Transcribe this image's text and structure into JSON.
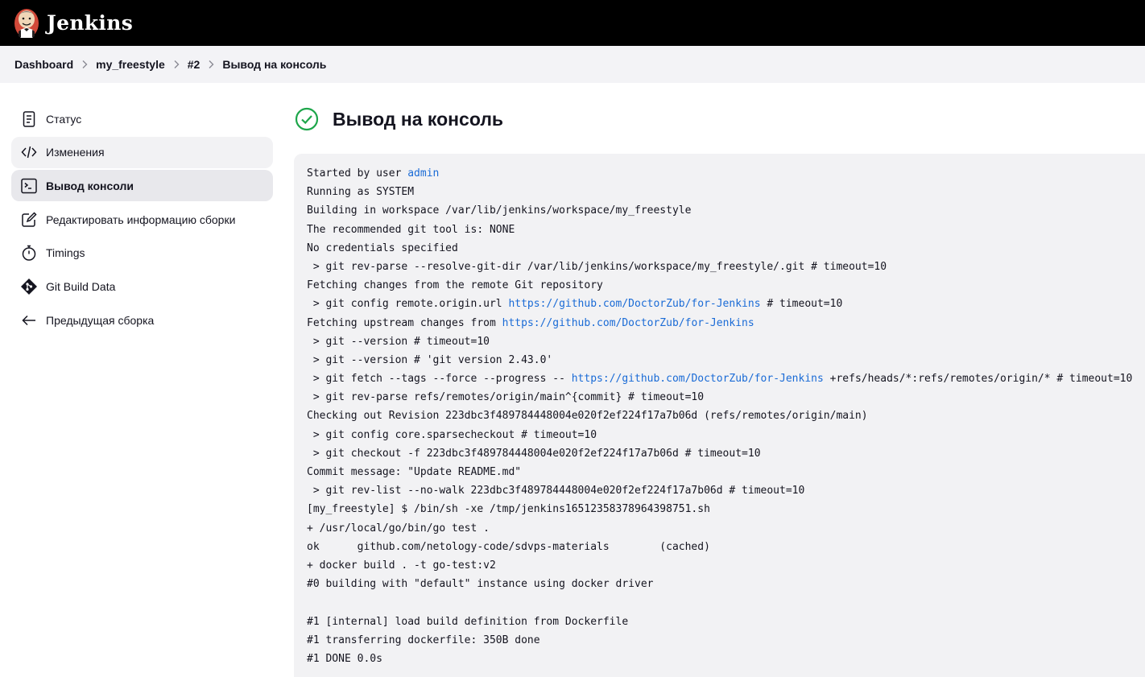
{
  "header": {
    "app_title": "Jenkins",
    "logo_icon": "jenkins-butler-icon"
  },
  "breadcrumb": {
    "items": [
      "Dashboard",
      "my_freestyle",
      "#2",
      "Вывод на консоль"
    ]
  },
  "sidebar": {
    "items": [
      {
        "label": "Статус",
        "icon": "document-icon"
      },
      {
        "label": "Изменения",
        "icon": "code-icon"
      },
      {
        "label": "Вывод консоли",
        "icon": "terminal-icon"
      },
      {
        "label": "Редактировать информацию сборки",
        "icon": "edit-icon"
      },
      {
        "label": "Timings",
        "icon": "stopwatch-icon"
      },
      {
        "label": "Git Build Data",
        "icon": "git-icon"
      },
      {
        "label": "Предыдущая сборка",
        "icon": "arrow-left-icon"
      }
    ]
  },
  "main": {
    "title": "Вывод на консоль",
    "status": "success",
    "status_color": "#1ea64b"
  },
  "colors": {
    "header_bg": "#000000",
    "breadcrumb_bg": "#f3f3f6",
    "console_bg": "#f2f2f4",
    "link": "#1a6bd6"
  },
  "console": {
    "lines": [
      [
        {
          "t": "Started by user "
        },
        {
          "t": "admin",
          "link": true
        }
      ],
      [
        {
          "t": "Running as SYSTEM"
        }
      ],
      [
        {
          "t": "Building in workspace /var/lib/jenkins/workspace/my_freestyle"
        }
      ],
      [
        {
          "t": "The recommended git tool is: NONE"
        }
      ],
      [
        {
          "t": "No credentials specified"
        }
      ],
      [
        {
          "t": " > git rev-parse --resolve-git-dir /var/lib/jenkins/workspace/my_freestyle/.git # timeout=10"
        }
      ],
      [
        {
          "t": "Fetching changes from the remote Git repository"
        }
      ],
      [
        {
          "t": " > git config remote.origin.url "
        },
        {
          "t": "https://github.com/DoctorZub/for-Jenkins",
          "link": true
        },
        {
          "t": " # timeout=10"
        }
      ],
      [
        {
          "t": "Fetching upstream changes from "
        },
        {
          "t": "https://github.com/DoctorZub/for-Jenkins",
          "link": true
        }
      ],
      [
        {
          "t": " > git --version # timeout=10"
        }
      ],
      [
        {
          "t": " > git --version # 'git version 2.43.0'"
        }
      ],
      [
        {
          "t": " > git fetch --tags --force --progress -- "
        },
        {
          "t": "https://github.com/DoctorZub/for-Jenkins",
          "link": true
        },
        {
          "t": " +refs/heads/*:refs/remotes/origin/* # timeout=10"
        }
      ],
      [
        {
          "t": " > git rev-parse refs/remotes/origin/main^{commit} # timeout=10"
        }
      ],
      [
        {
          "t": "Checking out Revision 223dbc3f489784448004e020f2ef224f17a7b06d (refs/remotes/origin/main)"
        }
      ],
      [
        {
          "t": " > git config core.sparsecheckout # timeout=10"
        }
      ],
      [
        {
          "t": " > git checkout -f 223dbc3f489784448004e020f2ef224f17a7b06d # timeout=10"
        }
      ],
      [
        {
          "t": "Commit message: \"Update README.md\""
        }
      ],
      [
        {
          "t": " > git rev-list --no-walk 223dbc3f489784448004e020f2ef224f17a7b06d # timeout=10"
        }
      ],
      [
        {
          "t": "[my_freestyle] $ /bin/sh -xe /tmp/jenkins16512358378964398751.sh"
        }
      ],
      [
        {
          "t": "+ /usr/local/go/bin/go test ."
        }
      ],
      [
        {
          "t": "ok  \tgithub.com/netology-code/sdvps-materials\t(cached)"
        }
      ],
      [
        {
          "t": "+ docker build . -t go-test:v2"
        }
      ],
      [
        {
          "t": "#0 building with \"default\" instance using docker driver"
        }
      ],
      [
        {
          "t": ""
        }
      ],
      [
        {
          "t": "#1 [internal] load build definition from Dockerfile"
        }
      ],
      [
        {
          "t": "#1 transferring dockerfile: 350B done"
        }
      ],
      [
        {
          "t": "#1 DONE 0.0s"
        }
      ]
    ]
  }
}
